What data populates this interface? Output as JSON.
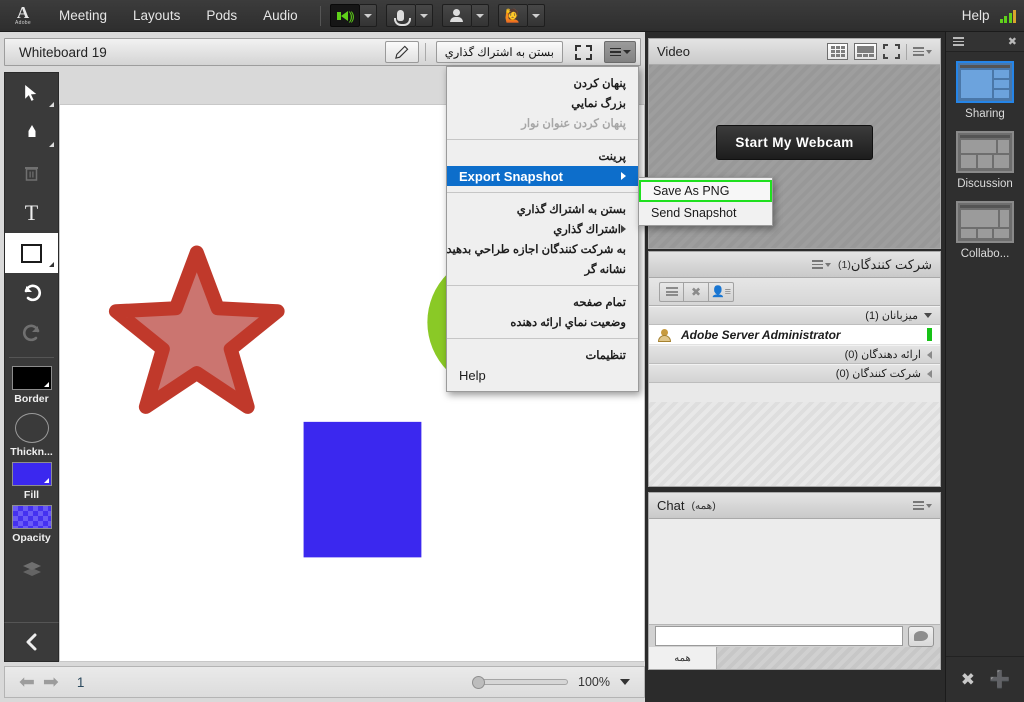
{
  "topbar": {
    "logo_glyph": "A",
    "logo_word": "Adobe",
    "menus": [
      "Meeting",
      "Layouts",
      "Pods",
      "Audio"
    ],
    "icons": [
      {
        "name": "speaker-icon",
        "state": "active"
      },
      {
        "name": "microphone-icon",
        "state": "normal"
      },
      {
        "name": "webcam-icon",
        "state": "normal"
      },
      {
        "name": "raise-hand-icon",
        "state": "normal"
      }
    ],
    "help_label": "Help",
    "signal_icon": "connection-signal-icon"
  },
  "whiteboard": {
    "title": "Whiteboard 19",
    "pencil_button": "draw-icon",
    "share_button_label": "بستن به اشتراك گذاري",
    "fullscreen_button": "fullscreen-icon",
    "pod_menu_button": "pod-options-icon",
    "tools": [
      {
        "name": "selection-tool",
        "glyph": "➤",
        "state": "normal"
      },
      {
        "name": "pen-tool",
        "glyph": "✑",
        "state": "normal"
      },
      {
        "name": "delete-tool",
        "glyph": "🗑",
        "state": "disabled"
      },
      {
        "name": "text-tool",
        "glyph": "T",
        "state": "normal"
      },
      {
        "name": "shape-tool",
        "glyph": "",
        "state": "selected"
      },
      {
        "name": "undo-tool",
        "glyph": "↶",
        "state": "normal"
      },
      {
        "name": "redo-tool",
        "glyph": "↷",
        "state": "disabled"
      }
    ],
    "swatches": [
      {
        "label": "Border",
        "color": "#000000"
      },
      {
        "label": "Thickn...",
        "color": ""
      },
      {
        "label": "Fill",
        "color": "#3b28ef"
      },
      {
        "label": "Opacity",
        "color": "#4531f0"
      }
    ],
    "layers_label": "layers-icon",
    "collapse_button": "collapse-panel-icon",
    "footer": {
      "prev_label": "previous-page-icon",
      "next_label": "next-page-icon",
      "page_number": "1",
      "zoom_value": "100%"
    },
    "shapes": [
      {
        "name": "star-shape",
        "fill": "#c9706b",
        "stroke": "#c0392b"
      },
      {
        "name": "circle-shape",
        "fill": "#8ac926"
      },
      {
        "name": "rectangle-shape",
        "fill": "#3b28ef"
      }
    ]
  },
  "wb_menu": {
    "items": [
      {
        "label": "پنهان كردن",
        "type": "rtl",
        "state": "normal"
      },
      {
        "label": "بزرگ نمايي",
        "type": "rtl",
        "state": "normal"
      },
      {
        "label": "پنهان كردن عنوان نوار",
        "type": "rtl",
        "state": "disabled"
      },
      {
        "type": "separator"
      },
      {
        "label": "پرينت",
        "type": "rtl",
        "state": "normal"
      },
      {
        "label": "Export Snapshot",
        "type": "ltr",
        "state": "highlighted",
        "has_submenu": true
      },
      {
        "type": "separator"
      },
      {
        "label": "بستن به اشتراك گذاري",
        "type": "rtl",
        "state": "normal"
      },
      {
        "label": "اشتراك گذاري",
        "type": "rtl",
        "state": "normal",
        "has_submenu": true
      },
      {
        "label": "به شركت كنندگان اجازه طراحي بدهيد",
        "type": "rtl",
        "state": "normal"
      },
      {
        "label": "نشانه گر",
        "type": "rtl",
        "state": "normal"
      },
      {
        "type": "separator"
      },
      {
        "label": "تمام صفحه",
        "type": "rtl",
        "state": "normal"
      },
      {
        "label": "وضعيت نماي ارائه دهنده",
        "type": "rtl",
        "state": "normal"
      },
      {
        "type": "separator"
      },
      {
        "label": "تنظيمات",
        "type": "rtl",
        "state": "normal"
      },
      {
        "label": "Help",
        "type": "ltr",
        "state": "normal"
      }
    ]
  },
  "submenu": {
    "items": [
      {
        "label": "Save As PNG",
        "state": "selected"
      },
      {
        "label": "Send Snapshot",
        "state": "normal"
      }
    ],
    "highlight_color": "#1fe01f"
  },
  "video_pod": {
    "title": "Video",
    "webcam_button": "Start My Webcam",
    "icons": [
      "grid-view-icon",
      "filmstrip-view-icon",
      "fullscreen-icon",
      "pod-options-icon"
    ]
  },
  "participants_pod": {
    "title": "شركت كنندگان",
    "count": "(1)",
    "toolbar_icons": [
      "list-view-icon",
      "grid-view-icon",
      "status-view-icon"
    ],
    "groups": [
      {
        "label": "ميزبانان (1)",
        "expanded": true,
        "members": [
          {
            "name": "Adobe Server Administrator",
            "role_icon": "host-avatar-icon",
            "status_color": "#17c217"
          }
        ]
      },
      {
        "label": "ارائه دهندگان (0)",
        "expanded": false,
        "members": []
      },
      {
        "label": "شركت كنندگان (0)",
        "expanded": false,
        "members": []
      }
    ]
  },
  "chat_pod": {
    "title": "Chat",
    "subtitle": "(همه)",
    "input_value": "",
    "input_placeholder": "",
    "send_icon": "chat-send-icon",
    "tab_label": "همه"
  },
  "layout_sidebar": {
    "menu_icon": "layout-options-icon",
    "close_icon": "close-icon",
    "items": [
      {
        "label": "Sharing",
        "selected": true
      },
      {
        "label": "Discussion",
        "selected": false
      },
      {
        "label": "Collabo...",
        "selected": false
      }
    ],
    "bottom_icons": [
      "tools-icon",
      "add-layout-icon"
    ]
  },
  "colors": {
    "accent_blue": "#0d6ecb",
    "highlight_green": "#1fe01f",
    "status_green": "#17c217",
    "chrome_dark": "#2f2f2f"
  }
}
